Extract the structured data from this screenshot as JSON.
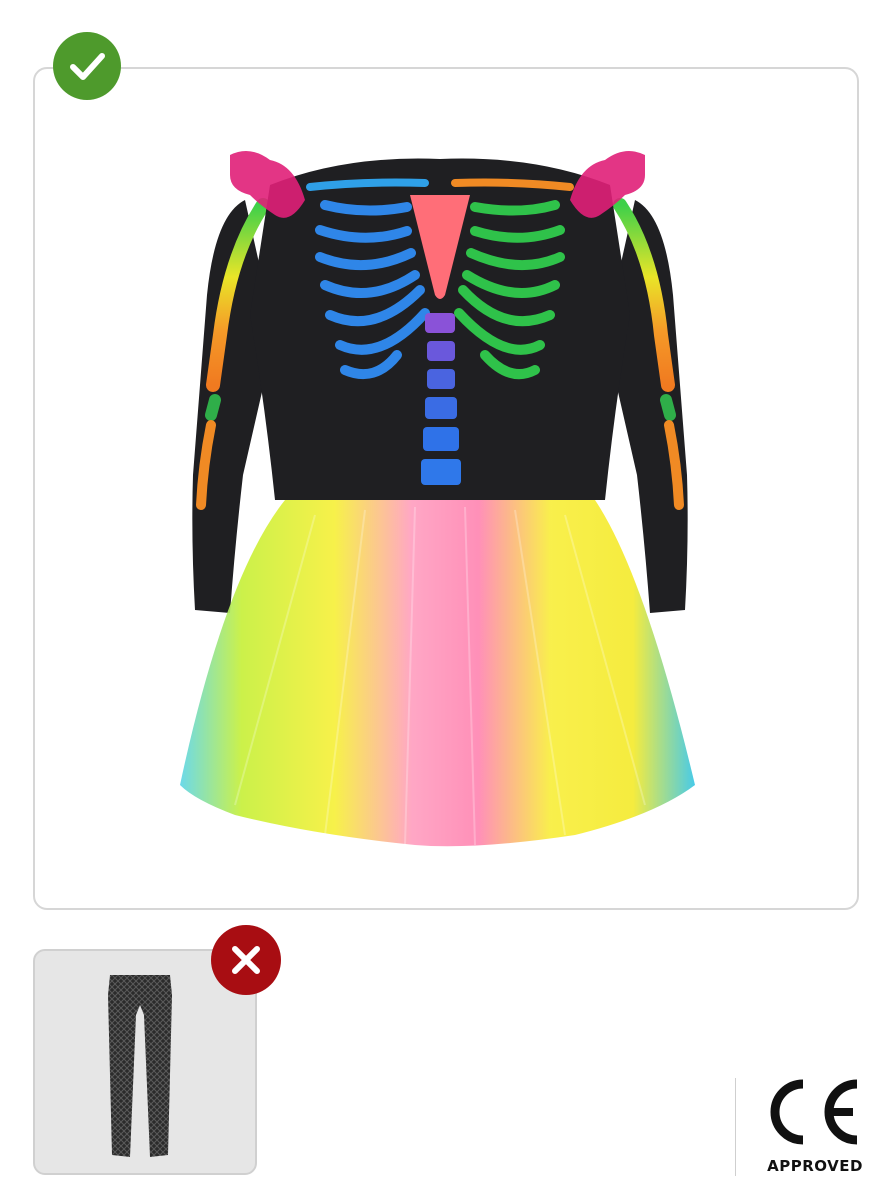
{
  "main_product": {
    "status": "included",
    "status_icon": "check-icon",
    "status_color": "#4e9a2c",
    "image": "rainbow-skeleton-tutu-dress"
  },
  "not_included": [
    {
      "status": "excluded",
      "status_icon": "close-icon",
      "status_color": "#a80d12",
      "image": "black-fishnet-tights"
    }
  ],
  "certification": {
    "mark": "CE",
    "label": "APPROVED"
  }
}
